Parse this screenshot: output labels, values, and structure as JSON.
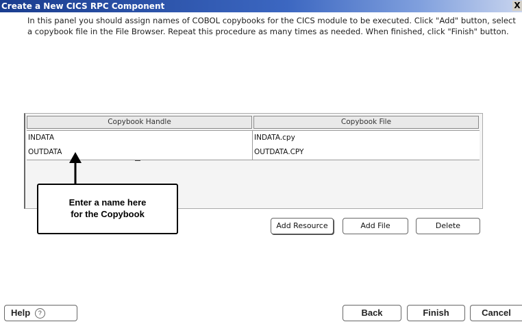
{
  "window": {
    "title": "Create a New CICS RPC Component",
    "close_glyph": "X"
  },
  "instructions": "In this panel you should assign names of COBOL copybooks for the CICS module to be executed. Click \"Add\" button, select a copybook file in the File Browser. Repeat this procedure as many times as needed. When finished, click \"Finish\" button.",
  "table": {
    "columns": [
      "Copybook Handle",
      "Copybook File"
    ],
    "rows": [
      {
        "handle": "INDATA",
        "file": "INDATA.cpy"
      },
      {
        "handle": "OUTDATA",
        "file": "OUTDATA.CPY"
      }
    ]
  },
  "callout": {
    "line1": "Enter a name here",
    "line2": "for the Copybook"
  },
  "actions": {
    "add_resource": "Add Resource",
    "add_file": "Add File",
    "delete": "Delete"
  },
  "footer": {
    "help": "Help",
    "help_glyph": "?",
    "back": "Back",
    "finish": "Finish",
    "cancel": "Cancel"
  }
}
